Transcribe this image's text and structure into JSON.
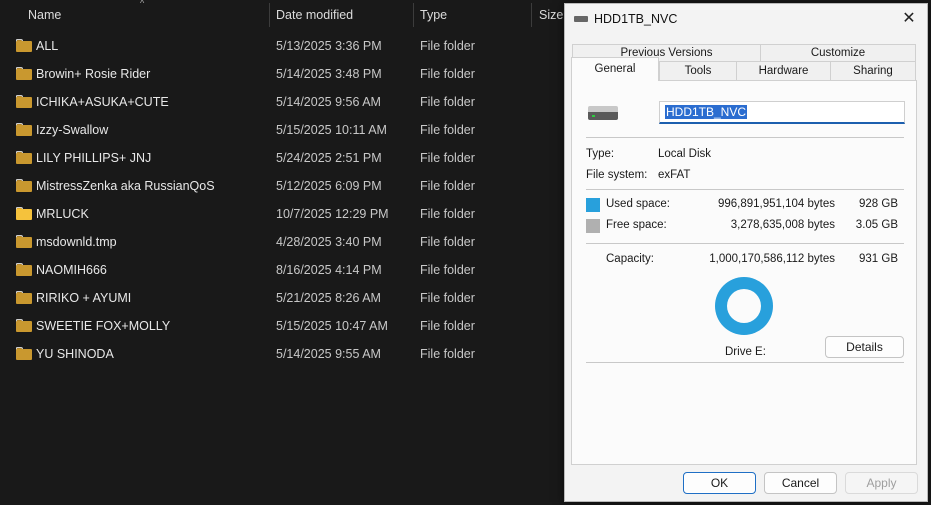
{
  "columns": {
    "name": "Name",
    "date_modified": "Date modified",
    "type": "Type",
    "size": "Size"
  },
  "files": [
    {
      "name": "ALL",
      "date": "5/13/2025 3:36 PM",
      "type": "File folder"
    },
    {
      "name": "Browin+ Rosie Rider",
      "date": "5/14/2025 3:48 PM",
      "type": "File folder"
    },
    {
      "name": "ICHIKA+ASUKA+CUTE",
      "date": "5/14/2025 9:56 AM",
      "type": "File folder"
    },
    {
      "name": "Izzy-Swallow",
      "date": "5/15/2025 10:11 AM",
      "type": "File folder"
    },
    {
      "name": "LILY PHILLIPS+ JNJ",
      "date": "5/24/2025 2:51 PM",
      "type": "File folder"
    },
    {
      "name": "MistressZenka aka RussianQoS",
      "date": "5/12/2025 6:09 PM",
      "type": "File folder"
    },
    {
      "name": "MRLUCK",
      "date": "10/7/2025 12:29 PM",
      "type": "File folder"
    },
    {
      "name": "msdownld.tmp",
      "date": "4/28/2025 3:40 PM",
      "type": "File folder"
    },
    {
      "name": "NAOMIH666",
      "date": "8/16/2025 4:14 PM",
      "type": "File folder"
    },
    {
      "name": "RIRIKO + AYUMI",
      "date": "5/21/2025 8:26 AM",
      "type": "File folder"
    },
    {
      "name": "SWEETIE FOX+MOLLY",
      "date": "5/15/2025 10:47 AM",
      "type": "File folder"
    },
    {
      "name": "YU SHINODA",
      "date": "5/14/2025 9:55 AM",
      "type": "File folder"
    }
  ],
  "dialog": {
    "title": "HDD1TB_NVC",
    "tabs_top": [
      "Previous Versions",
      "Customize"
    ],
    "tabs_bottom": [
      "General",
      "Tools",
      "Hardware",
      "Sharing"
    ],
    "active_tab": "General",
    "drive_name": "HDD1TB_NVC",
    "type_label": "Type:",
    "type_value": "Local Disk",
    "fs_label": "File system:",
    "fs_value": "exFAT",
    "used_label": "Used space:",
    "used_bytes": "996,891,951,104 bytes",
    "used_size": "928 GB",
    "free_label": "Free space:",
    "free_bytes": "3,278,635,008 bytes",
    "free_size": "3.05 GB",
    "capacity_label": "Capacity:",
    "capacity_bytes": "1,000,170,586,112 bytes",
    "capacity_size": "931 GB",
    "drive_label": "Drive E:",
    "details_label": "Details",
    "ok_label": "OK",
    "cancel_label": "Cancel",
    "apply_label": "Apply",
    "used_color": "#28a0dc",
    "free_color": "#b0b0b0"
  }
}
